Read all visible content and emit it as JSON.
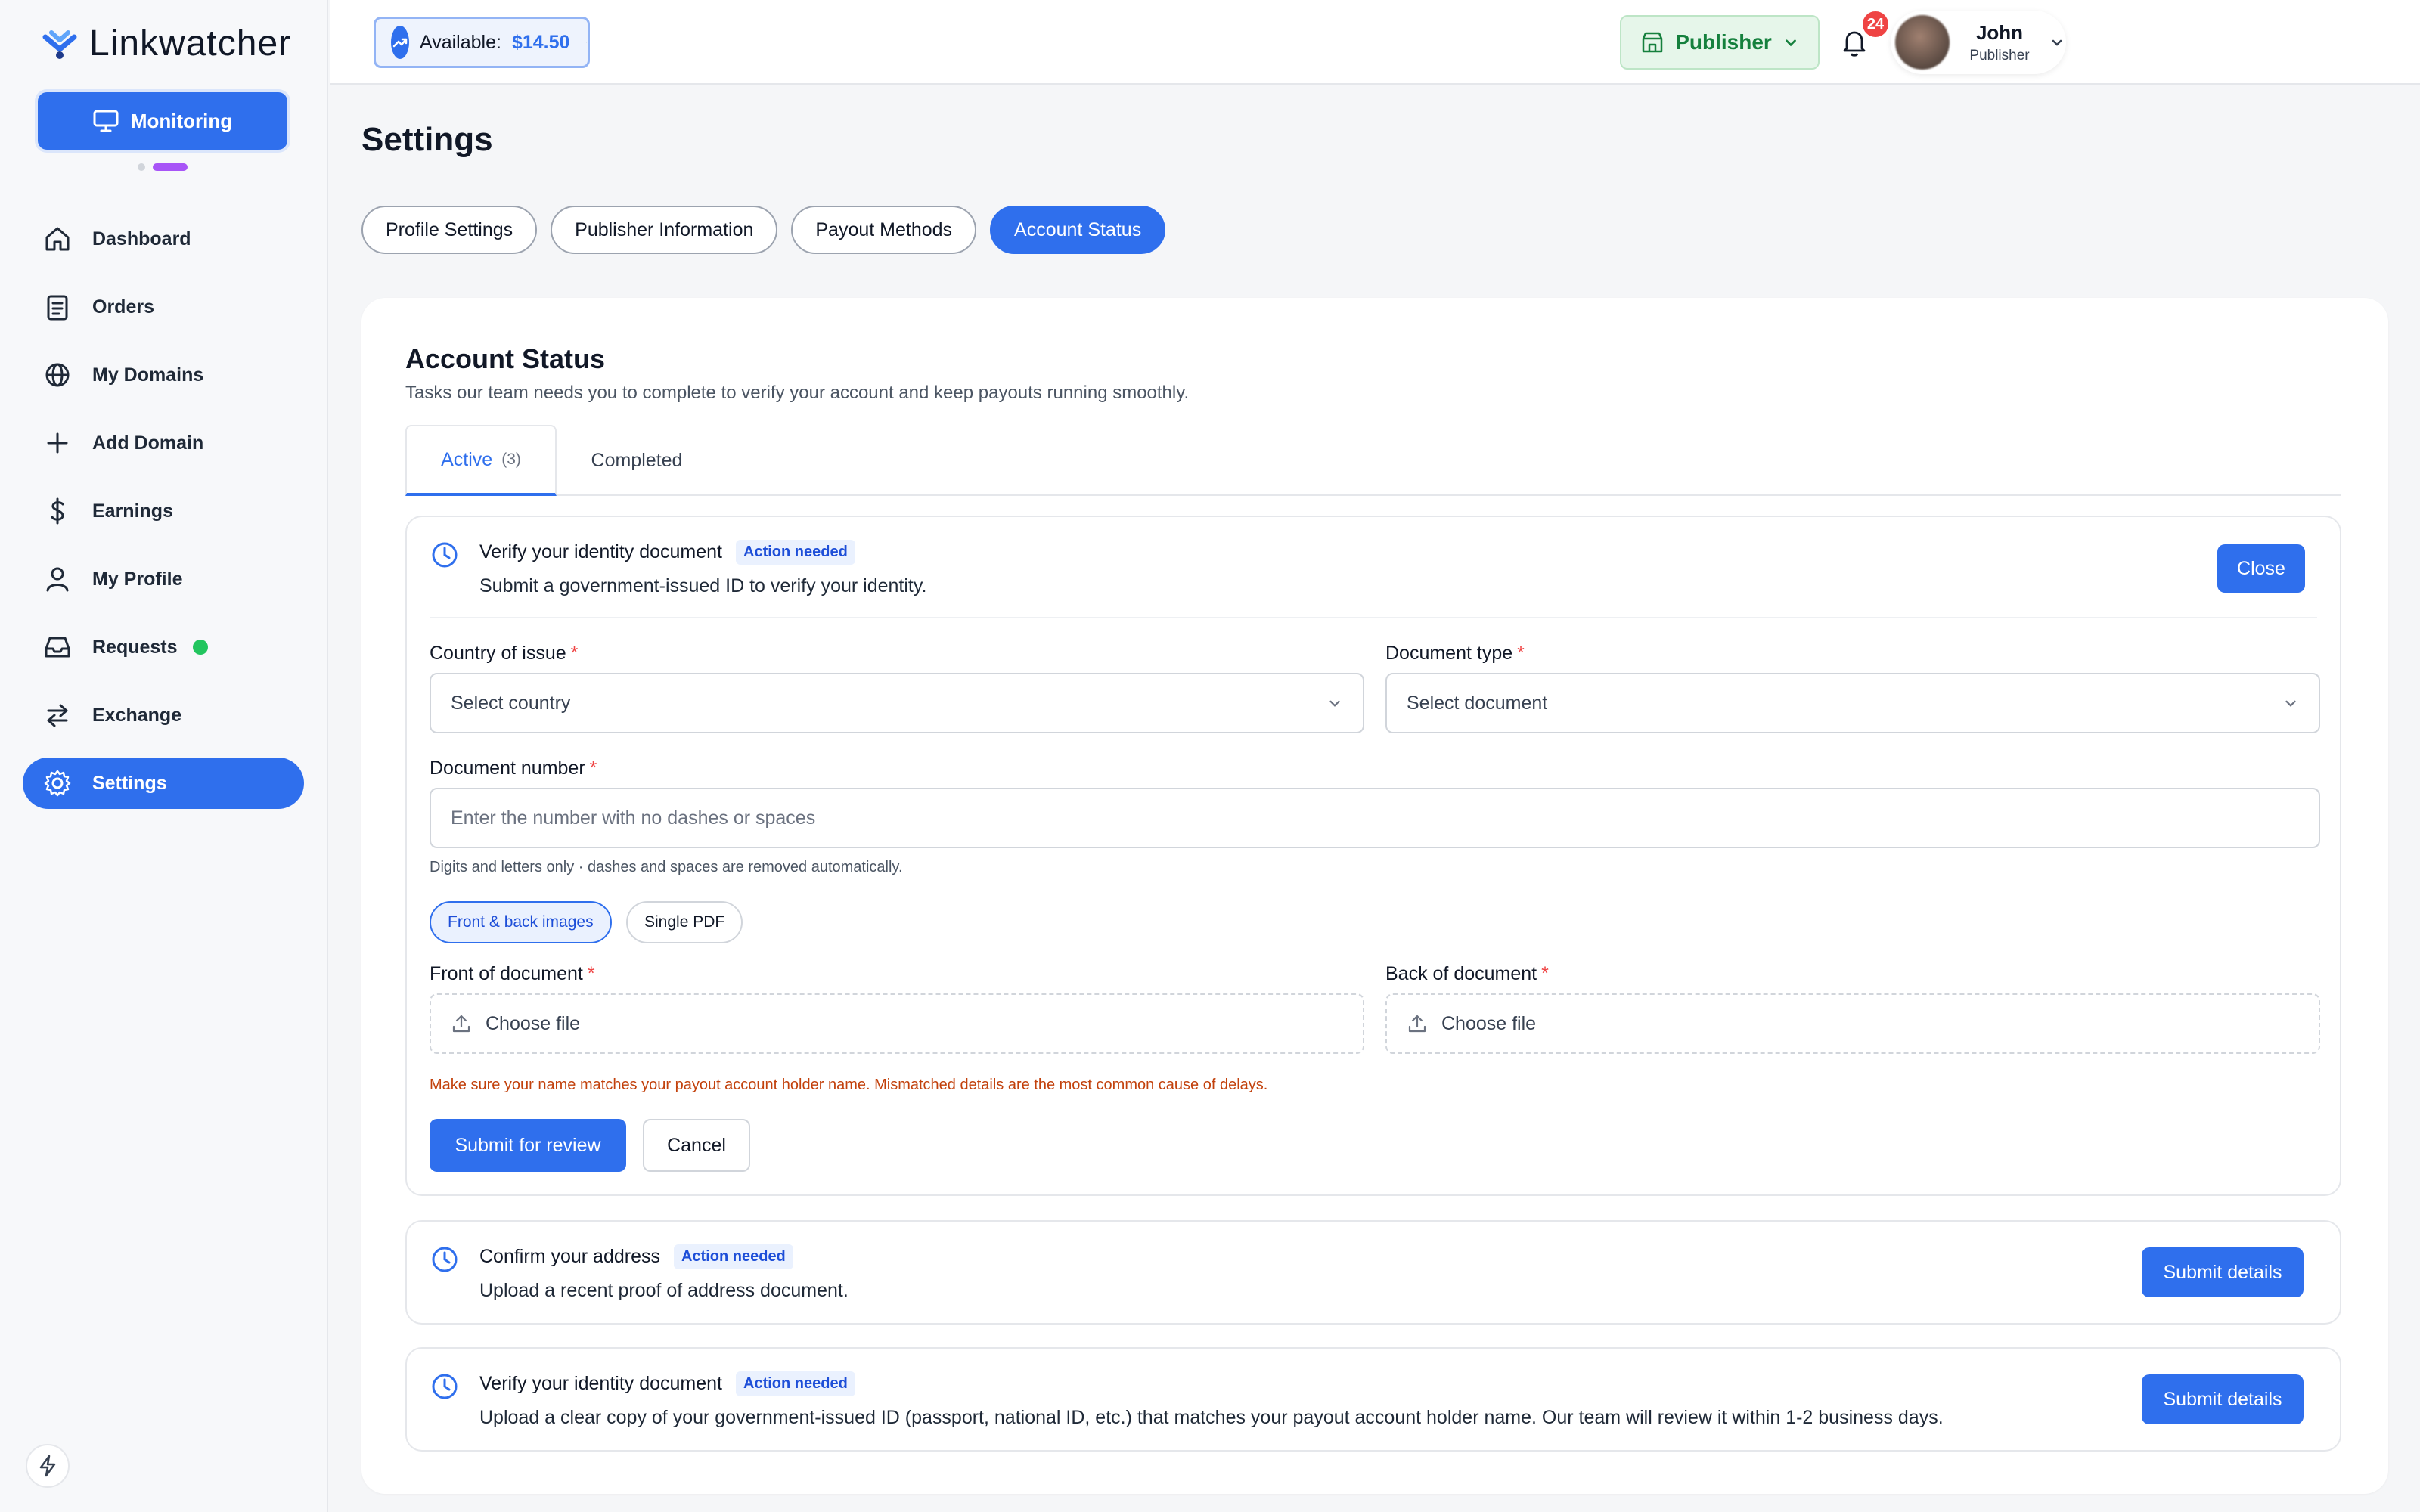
{
  "app": {
    "name": "Linkwatcher"
  },
  "sidebar": {
    "monitor_label": "Monitoring",
    "items": [
      {
        "label": "Dashboard",
        "icon": "home-icon"
      },
      {
        "label": "Orders",
        "icon": "clipboard-icon"
      },
      {
        "label": "My Domains",
        "icon": "globe-icon"
      },
      {
        "label": "Add Domain",
        "icon": "plus-icon"
      },
      {
        "label": "Earnings",
        "icon": "dollar-icon"
      },
      {
        "label": "My Profile",
        "icon": "user-icon"
      },
      {
        "label": "Requests",
        "icon": "inbox-icon"
      },
      {
        "label": "Exchange",
        "icon": "exchange-icon"
      },
      {
        "label": "Settings",
        "icon": "gear-icon"
      }
    ],
    "active_item": "Settings"
  },
  "topbar": {
    "available_label": "Available:",
    "available_amount": "$14.50",
    "role_switch": "Publisher",
    "notifications_count": "24",
    "user_name": "John",
    "user_role": "Publisher"
  },
  "page": {
    "title": "Settings",
    "tabs": [
      "Profile Settings",
      "Publisher Information",
      "Payout Methods",
      "Account Status"
    ],
    "active_tab": "Account Status"
  },
  "account_status": {
    "title": "Account Status",
    "subtitle": "Tasks our team needs you to complete to verify your account and keep payouts running smoothly.",
    "tabs": {
      "active_label": "Active",
      "active_count": "(3)",
      "completed_label": "Completed"
    }
  },
  "tasks": [
    {
      "title": "Verify your identity document",
      "badge": "Action needed",
      "description": "Submit a government-issued ID to verify your identity.",
      "button": "Close",
      "expanded": true
    },
    {
      "title": "Confirm your address",
      "badge": "Action needed",
      "description": "Upload a recent proof of address document.",
      "button": "Submit details"
    },
    {
      "title": "Verify your identity document",
      "badge": "Action needed",
      "description": "Upload a clear copy of your government-issued ID (passport, national ID, etc.) that matches your payout account holder name. Our team will review it within 1-2 business days.",
      "button": "Submit details"
    }
  ],
  "form": {
    "country_label": "Country of issue",
    "country_placeholder": "Select country",
    "doctype_label": "Document type",
    "doctype_placeholder": "Select document",
    "docnum_label": "Document number",
    "docnum_placeholder": "Enter the number with no dashes or spaces",
    "docnum_hint": "Digits and letters only · dashes and spaces are removed automatically.",
    "mode_options": [
      "Front & back images",
      "Single PDF"
    ],
    "mode_selected": "Front & back images",
    "front_label": "Front of document",
    "back_label": "Back of document",
    "choose_file": "Choose file",
    "warning": "Make sure your name matches your payout account holder name. Mismatched details are the most common cause of delays.",
    "submit": "Submit for review",
    "cancel": "Cancel",
    "required_mark": "*"
  },
  "colors": {
    "accent": "#2f6fed",
    "success": "#22c55e",
    "danger": "#ef4444",
    "warning_text": "#c2410c"
  }
}
